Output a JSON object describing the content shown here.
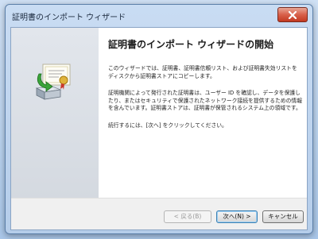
{
  "window": {
    "title": "証明書のインポート ウィザード"
  },
  "wizard": {
    "heading": "証明書のインポート ウィザードの開始",
    "paragraphs": [
      "このウィザードでは、証明書、証明書信頼リスト、および証明書失効リストをディスクから証明書ストアにコピーします。",
      "証明機関によって発行された証明書は、ユーザー ID を確認し、データを保護したり、またはセキュリティで保護されたネットワーク接続を提供するための情報を含んでいます。証明書ストアは、証明書が保管されるシステム上の領域です。",
      "続行するには、[次へ] をクリックしてください。"
    ]
  },
  "buttons": {
    "back": "< 戻る(B)",
    "next": "次へ(N) >",
    "cancel": "キャンセル"
  },
  "icons": {
    "close": "close-icon",
    "certificate": "certificate-import-icon"
  }
}
